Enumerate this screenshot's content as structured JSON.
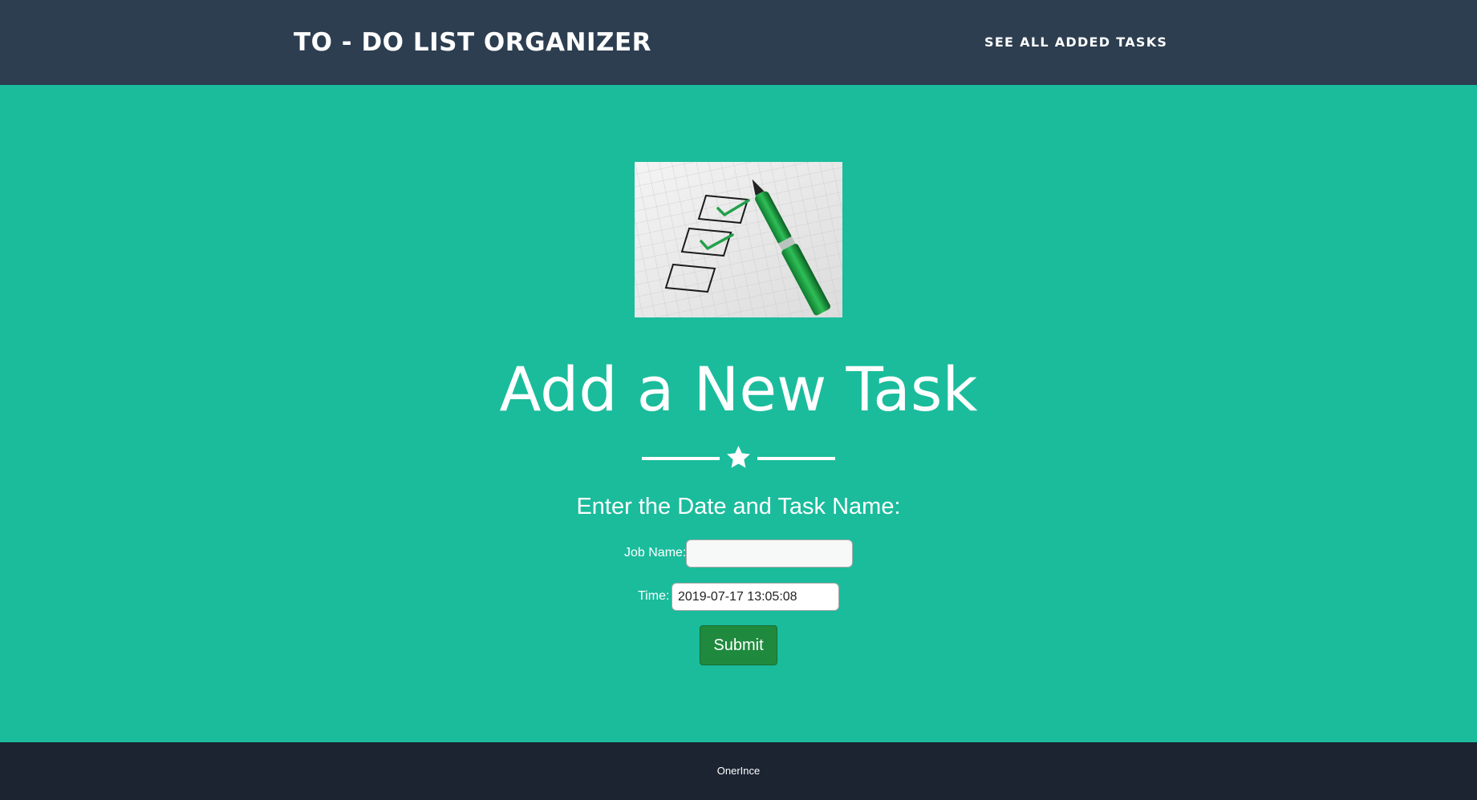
{
  "navbar": {
    "brand": "TO - DO LIST ORGANIZER",
    "link": "SEE ALL ADDED TASKS"
  },
  "hero": {
    "image_icon": "checklist-pen-icon",
    "heading": "Add a New Task",
    "divider_icon": "star-icon",
    "subheading": "Enter the Date and Task Name:"
  },
  "form": {
    "job_label": "Job Name:",
    "job_value": "",
    "time_label": "Time:",
    "time_value": "2019-07-17 13:05:08",
    "submit_label": "Submit"
  },
  "footer": {
    "text": "OnerInce"
  },
  "colors": {
    "navbar": "#2c3e50",
    "accent": "#1abc9c",
    "button": "#1f8a3e",
    "footer": "#1c2331"
  }
}
